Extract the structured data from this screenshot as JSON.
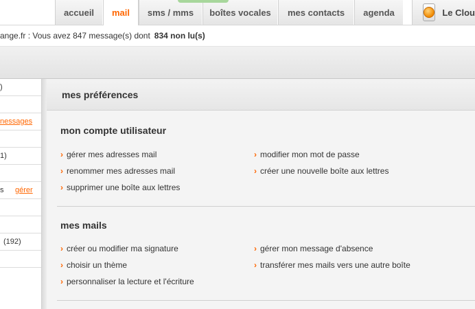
{
  "tabs": [
    {
      "label": "accueil",
      "active": false
    },
    {
      "label": "mail",
      "active": true
    },
    {
      "label": "sms / mms",
      "active": false
    },
    {
      "label": "boîtes vocales",
      "active": false
    },
    {
      "label": "mes contacts",
      "active": false
    },
    {
      "label": "agenda",
      "active": false
    }
  ],
  "cloud": {
    "label": "Le Clou"
  },
  "status": {
    "text": "ange.fr : Vous avez 847 message(s) dont",
    "unread": "834 non lu(s)"
  },
  "left_panel": {
    "rows": [
      {
        "text": ")",
        "link": ""
      },
      {
        "text": "",
        "link": ""
      },
      {
        "text": "",
        "link": "nessages"
      },
      {
        "text": "",
        "link": ""
      },
      {
        "text": "1)",
        "link": ""
      },
      {
        "text": "",
        "link": ""
      },
      {
        "text": "s",
        "link": "gérer"
      },
      {
        "text": "",
        "link": ""
      },
      {
        "text": "",
        "link": ""
      },
      {
        "text": "(192)",
        "link": ""
      },
      {
        "text": "",
        "link": ""
      }
    ]
  },
  "main": {
    "header": "mes préférences",
    "sections": [
      {
        "title": "mon compte utilisateur",
        "links_left": [
          "gérer mes adresses mail",
          "renommer mes adresses mail",
          "supprimer une boîte aux lettres"
        ],
        "links_right": [
          "modifier mon mot de passe",
          "créer une nouvelle boîte aux lettres"
        ]
      },
      {
        "title": "mes mails",
        "links_left": [
          "créer ou modifier ma signature",
          "choisir un thème",
          "personnaliser la lecture et l'écriture"
        ],
        "links_right": [
          "gérer mon message d'absence",
          "transférer mes mails vers une autre boîte"
        ]
      }
    ]
  },
  "colors": {
    "accent": "#ff6600",
    "text": "#333333"
  },
  "icons": {
    "bullet": "chevron-right-icon",
    "cloud": "cloud-icon"
  }
}
